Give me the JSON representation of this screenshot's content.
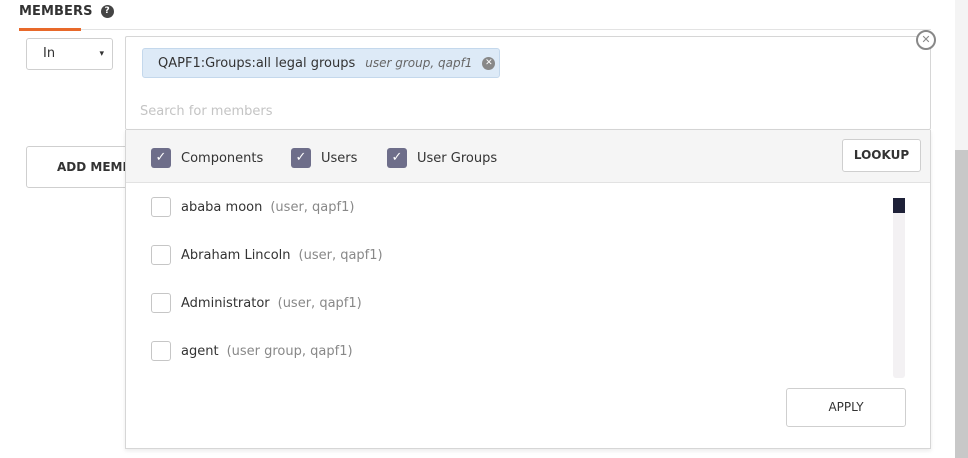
{
  "section": {
    "title": "MEMBERS",
    "help_icon": "?"
  },
  "operator_select": {
    "value": "In",
    "caret": "▾"
  },
  "add_member_button": {
    "label": "ADD MEMBE"
  },
  "members_input": {
    "chips": [
      {
        "name": "QAPF1:Groups:all legal groups",
        "meta": "user group, qapf1"
      }
    ],
    "placeholder": "Search for members",
    "clear_icon": "✕"
  },
  "filters": {
    "components": {
      "label": "Components",
      "checked": true
    },
    "users": {
      "label": "Users",
      "checked": true
    },
    "user_groups": {
      "label": "User Groups",
      "checked": true
    },
    "check_glyph": "✓"
  },
  "lookup_button": {
    "label": "LOOKUP"
  },
  "results": [
    {
      "name": "ababa moon",
      "meta": "(user, qapf1)"
    },
    {
      "name": "Abraham Lincoln",
      "meta": "(user, qapf1)"
    },
    {
      "name": "Administrator",
      "meta": "(user, qapf1)"
    },
    {
      "name": "agent",
      "meta": "(user group, qapf1)"
    }
  ],
  "apply_button": {
    "label": "APPLY"
  },
  "colors": {
    "accent": "#e8692a",
    "chip_bg": "#ddeaf7",
    "checkbox_checked": "#6e6e8a",
    "scroll_thumb": "#1e2138"
  }
}
